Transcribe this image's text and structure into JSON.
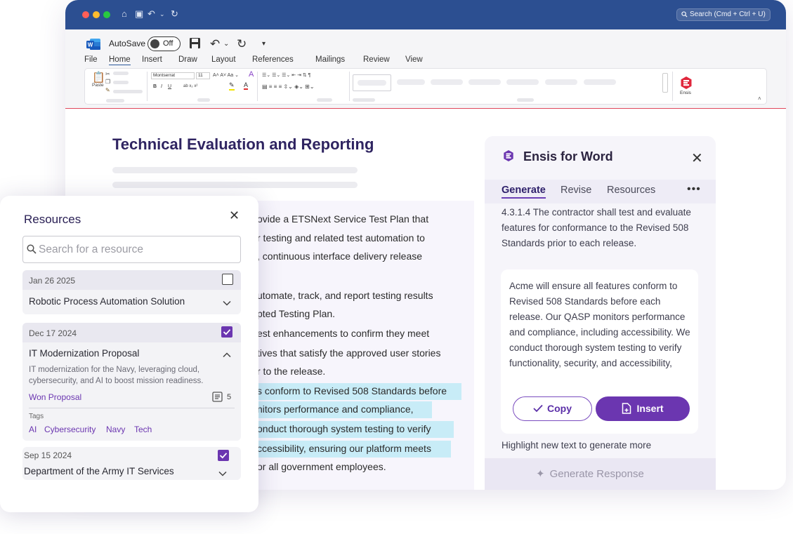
{
  "titlebar": {
    "search_label": "Search (Cmd + Ctrl + U)",
    "traffic_lights": [
      "#ff5f57",
      "#febc2e",
      "#28c840"
    ]
  },
  "toolbar": {
    "autosave_label": "AutoSave",
    "autosave_state": "Off",
    "menus": [
      "File",
      "Home",
      "Insert",
      "Draw",
      "Layout",
      "References",
      "Mailings",
      "Review",
      "View"
    ],
    "active_menu": "Home",
    "font_name": "Montserrat",
    "font_size": "11",
    "paste_label": "Paste",
    "ensis_addin_label": "Ensis"
  },
  "document": {
    "title": "Technical Evaluation and Reporting",
    "lines": [
      "ovide a ETSNext Service Test Plan that",
      "r testing and related test automation to",
      ", continuous interface delivery release",
      "utomate, track, and report testing results",
      "pted Testing Plan.",
      "est enhancements to confirm they meet",
      "tives that satisfy the approved user stories",
      "r to the release.",
      "s conform to Revised 508 Standards before",
      "nitors performance and compliance,",
      "onduct thorough system testing to verify",
      "ccessibility, ensuring our platform meets",
      "or all government employees."
    ]
  },
  "ensis": {
    "title": "Ensis for Word",
    "tabs": [
      "Generate",
      "Revise",
      "Resources"
    ],
    "active_tab": "Generate",
    "more_label": "•••",
    "requirement": "4.3.1.4 The contractor shall test and evaluate features for conformance to the Revised 508 Standards prior to each release.",
    "generated_text": "Acme will ensure all features conform to Revised 508 Standards before each release. Our QASP monitors performance and compliance, including accessibility. We conduct thorough system testing to verify functionality, security, and accessibility,",
    "copy_label": "Copy",
    "insert_label": "Insert",
    "hint": "Highlight new text to generate more",
    "generate_button": "Generate Response",
    "accent_color": "#6b36b0"
  },
  "resources": {
    "title": "Resources",
    "search_placeholder": "Search for a resource",
    "items": [
      {
        "date": "Jan 26 2025",
        "name": "Robotic Process Automation Solution",
        "checked": false,
        "expanded": false
      },
      {
        "date": "Dec 17 2024",
        "name": "IT Modernization Proposal",
        "checked": true,
        "expanded": true,
        "description": "IT modernization for the Navy, leveraging cloud, cybersecurity, and AI to boost mission readiness.",
        "status": "Won Proposal",
        "doc_count": "5",
        "tags_label": "Tags",
        "tags": [
          "AI",
          "Cybersecurity",
          "Navy",
          "Tech"
        ]
      },
      {
        "date": "Sep 15 2024",
        "name": "Department of the Army IT Services",
        "checked": true,
        "expanded": false
      }
    ]
  }
}
